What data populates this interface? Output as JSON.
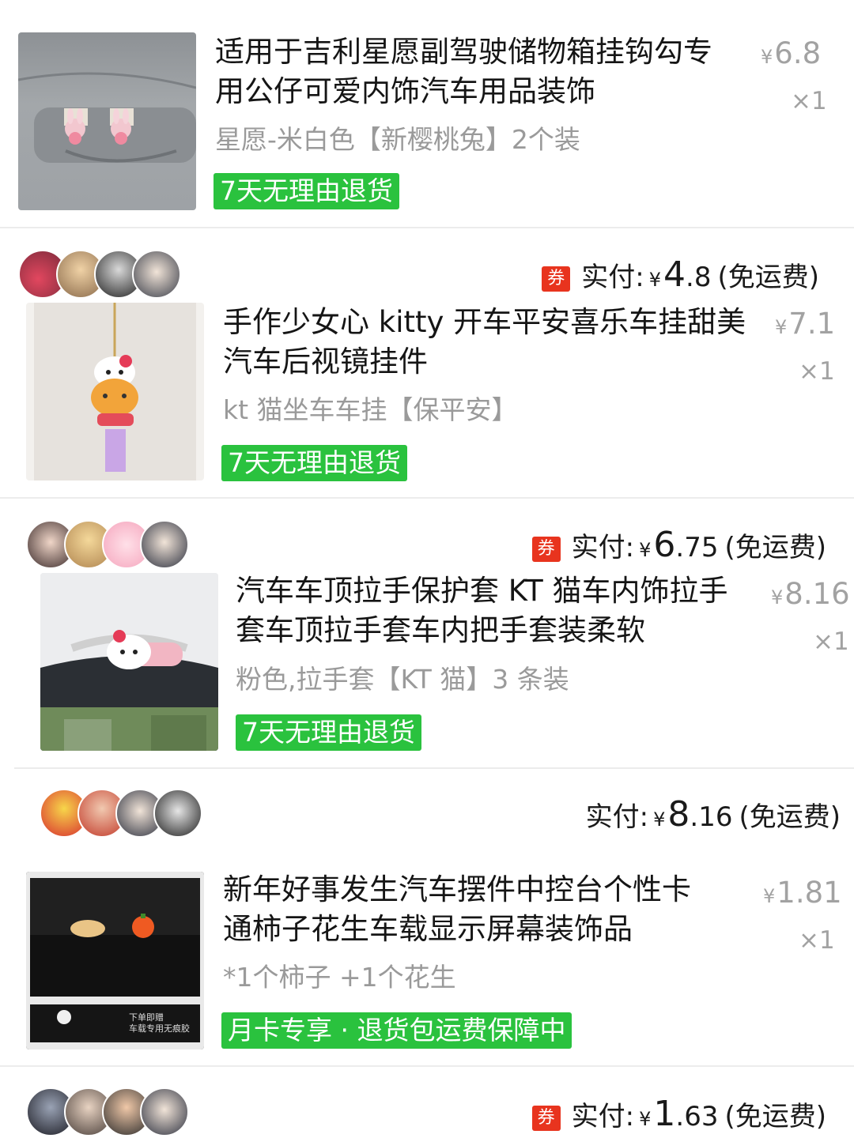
{
  "orders": [
    {
      "title_line1": "适用于吉利星愿副驾驶储物箱挂钩勾专",
      "title_line2": "用公仔可爱内饰汽车用品装饰",
      "spec": "星愿-米白色【新樱桃兔】2个装",
      "tag": "7天无理由退货",
      "price_symbol": "¥",
      "price": "6.8",
      "qty": "×1"
    },
    {
      "coupon": "券",
      "paid_label": "实付:",
      "paid_symbol": "¥",
      "paid_int": "4",
      "paid_dec": ".8",
      "shipping": "(免运费)",
      "title_line1": "手作少女心 kitty 开车平安喜乐车挂甜美",
      "title_line2": "汽车后视镜挂件",
      "spec": "kt 猫坐车车挂【保平安】",
      "tag": "7天无理由退货",
      "price_symbol": "¥",
      "price": "7.1",
      "qty": "×1"
    },
    {
      "coupon": "券",
      "paid_label": "实付:",
      "paid_symbol": "¥",
      "paid_int": "6",
      "paid_dec": ".75",
      "shipping": "(免运费)",
      "title_line1": "汽车车顶拉手保护套 KT 猫车内饰拉手",
      "title_line2": "套车顶拉手套车内把手套装柔软",
      "spec": "粉色,拉手套【KT 猫】3 条装",
      "tag": "7天无理由退货",
      "price_symbol": "¥",
      "price": "8.16",
      "qty": "×1"
    },
    {
      "paid_label": "实付:",
      "paid_symbol": "¥",
      "paid_int": "8",
      "paid_dec": ".16",
      "shipping": "(免运费)",
      "title_line1": "新年好事发生汽车摆件中控台个性卡",
      "title_line2": "通柿子花生车载显示屏幕装饰品",
      "spec": "*1个柿子 +1个花生",
      "tag": "月卡专享 · 退货包运费保障中",
      "price_symbol": "¥",
      "price": "1.81",
      "qty": "×1",
      "thumb_text_1": "下单即赠",
      "thumb_text_2": "车载专用无痕胶"
    },
    {
      "coupon": "券",
      "paid_label": "实付:",
      "paid_symbol": "¥",
      "paid_int": "1",
      "paid_dec": ".63",
      "shipping": "(免运费)"
    }
  ],
  "colors": {
    "tag_green": "#2ac23e",
    "coupon_red": "#e8341e",
    "muted_gray": "#9a9a9a"
  }
}
